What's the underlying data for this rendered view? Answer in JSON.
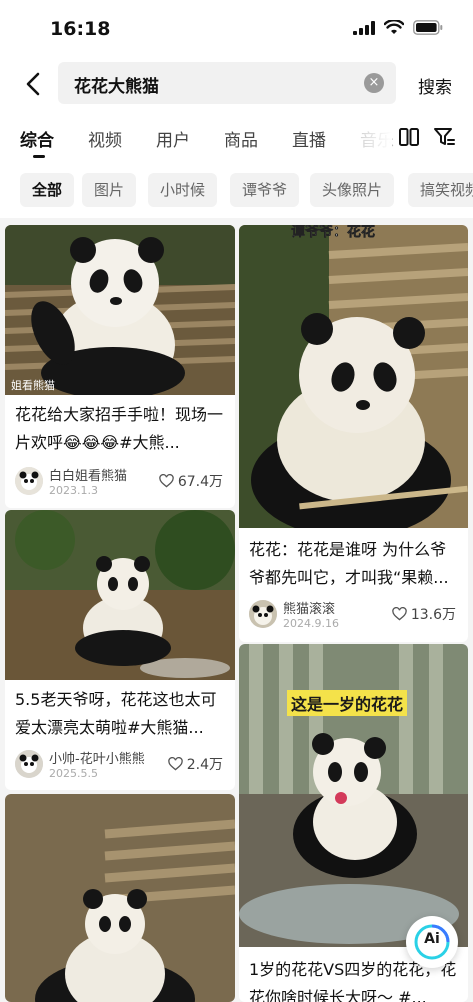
{
  "status_bar": {
    "time": "16:18"
  },
  "search": {
    "query": "花花大熊猫",
    "clear_icon": "×",
    "button_label": "搜索"
  },
  "tabs": [
    {
      "label": "综合"
    },
    {
      "label": "视频"
    },
    {
      "label": "用户"
    },
    {
      "label": "商品"
    },
    {
      "label": "直播"
    },
    {
      "label": "音乐"
    }
  ],
  "chips": [
    {
      "label": "全部"
    },
    {
      "label": "图片"
    },
    {
      "label": "小时候"
    },
    {
      "label": "谭爷爷"
    },
    {
      "label": "头像照片"
    },
    {
      "label": "搞笑视频"
    }
  ],
  "feed": [
    {
      "title": "花花给大家招手手啦！现场一片欢呼😂😂😂#大熊...",
      "author": "白白姐看熊猫",
      "date": "2023.1.3",
      "likes": "67.4万",
      "thumb_caption": "姐看熊猫"
    },
    {
      "title": "花花：花花是谁呀 为什么爷爷都先叫它，才叫我“果赖...",
      "author": "熊猫滚滚",
      "date": "2024.9.16",
      "likes": "13.6万",
      "thumb_caption": "谭爷爷：花花"
    },
    {
      "title": "5.5老天爷呀，花花这也太可爱太漂亮太萌啦#大熊猫...",
      "author": "小帅-花叶小熊熊",
      "date": "2025.5.5",
      "likes": "2.4万",
      "thumb_caption": ""
    },
    {
      "title": "1岁的花花VS四岁的花花，花花你啥时候长大呀～ #...",
      "author": "",
      "date": "",
      "likes": "",
      "thumb_caption": "这是一岁的花花"
    },
    {
      "title": "",
      "author": "",
      "date": "",
      "likes": "",
      "thumb_caption": ""
    }
  ],
  "floating": {
    "ai_label": "Ai"
  }
}
